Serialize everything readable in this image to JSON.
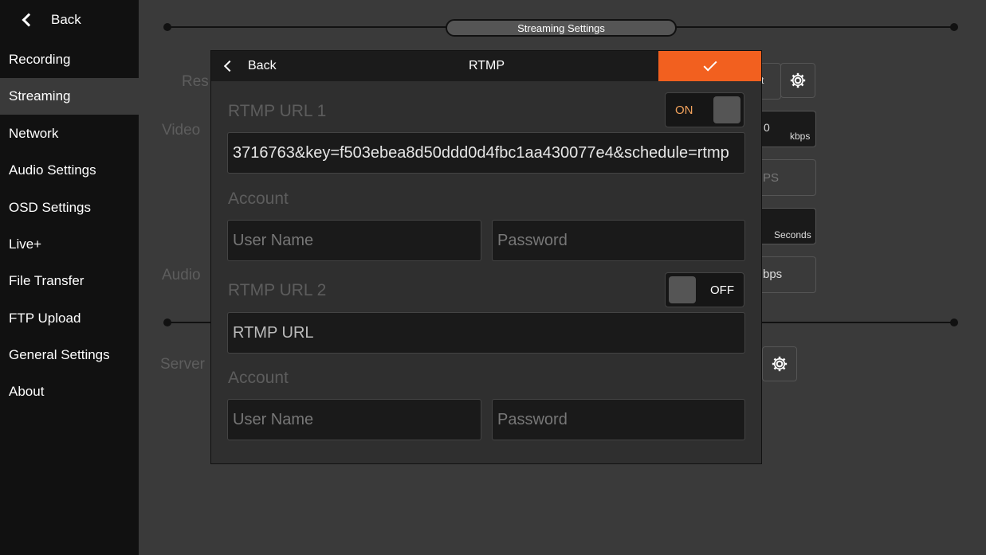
{
  "sidebar": {
    "back_label": "Back",
    "items": [
      {
        "label": "Recording"
      },
      {
        "label": "Streaming"
      },
      {
        "label": "Network"
      },
      {
        "label": "Audio Settings"
      },
      {
        "label": "OSD Settings"
      },
      {
        "label": "Live+"
      },
      {
        "label": "File Transfer"
      },
      {
        "label": "FTP Upload"
      },
      {
        "label": "General Settings"
      },
      {
        "label": "About"
      }
    ],
    "active_index": 1
  },
  "background": {
    "section_title": "Streaming Settings",
    "labels": {
      "res": "Res",
      "video": "Video",
      "audio": "Audio",
      "server": "Server"
    },
    "boxes": {
      "res_tail": "t",
      "video_bitrate_tail": "0",
      "video_bitrate_unit": "kbps",
      "fps_tail": "PS",
      "gop_unit": "Seconds",
      "audio_bitrate_tail": "bps"
    }
  },
  "dialog": {
    "back_label": "Back",
    "title": "RTMP",
    "url1": {
      "label": "RTMP URL 1",
      "toggle_label": "ON",
      "value": "3716763&key=f503ebea8d50ddd0d4fbc1aa430077e4&schedule=rtmp",
      "account_label": "Account",
      "username_placeholder": "User Name",
      "password_placeholder": "Password"
    },
    "url2": {
      "label": "RTMP URL 2",
      "toggle_label": "OFF",
      "placeholder": "RTMP URL",
      "account_label": "Account",
      "username_placeholder": "User Name",
      "password_placeholder": "Password"
    }
  },
  "colors": {
    "accent": "#f2601f",
    "sidebar_bg": "#111111",
    "main_bg": "#3a3a3a",
    "dialog_bg": "#2f2f2f"
  },
  "icons": [
    "chevron-left-icon",
    "check-icon",
    "gear-icon"
  ]
}
